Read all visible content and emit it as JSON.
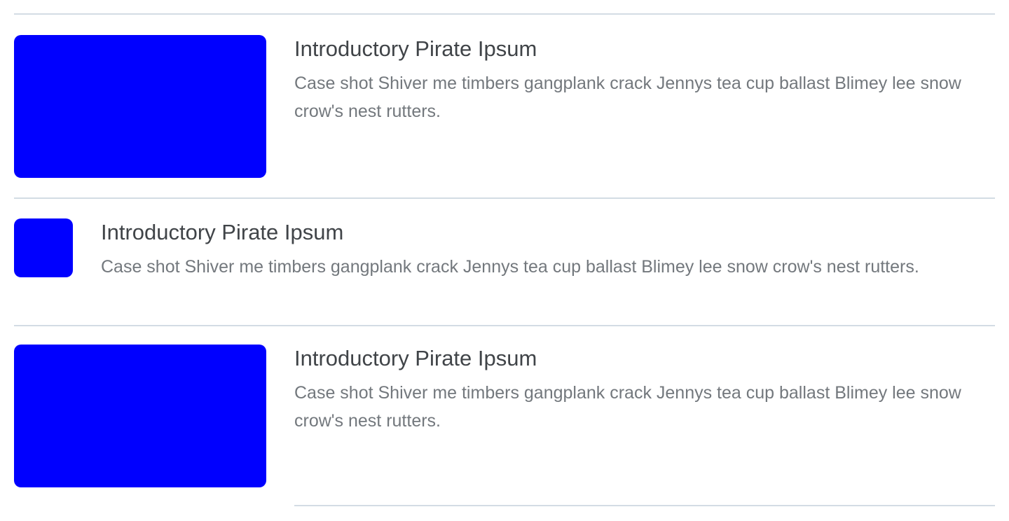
{
  "items": [
    {
      "title": "Introductory Pirate Ipsum",
      "description": "Case shot Shiver me timbers gangplank crack Jennys tea cup ballast Blimey lee snow crow's nest rutters.",
      "thumbnail_color": "#0000ff"
    },
    {
      "title": "Introductory Pirate Ipsum",
      "description": "Case shot Shiver me timbers gangplank crack Jennys tea cup ballast Blimey lee snow crow's nest rutters.",
      "thumbnail_color": "#0000ff"
    },
    {
      "title": "Introductory Pirate Ipsum",
      "description": "Case shot Shiver me timbers gangplank crack Jennys tea cup ballast Blimey lee snow crow's nest rutters.",
      "thumbnail_color": "#0000ff"
    }
  ],
  "divider_color": "#d3dce4"
}
